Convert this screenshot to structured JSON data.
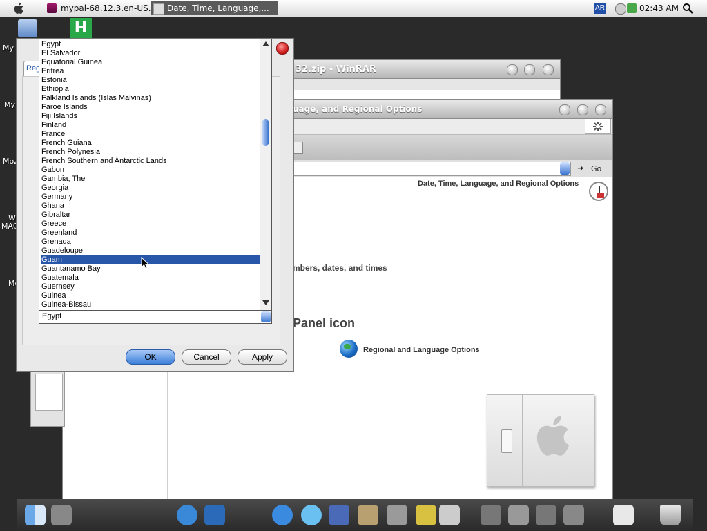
{
  "menubar": {
    "taskbar": [
      {
        "label": "mypal-68.12.3.en-US...."
      },
      {
        "label": "Date, Time, Language,..."
      }
    ],
    "lang": "AR",
    "clock": "02:43 AM"
  },
  "desktop": {
    "labels": [
      "My I",
      "My",
      "Moz",
      "W",
      "MAC",
      "Me"
    ]
  },
  "winrar": {
    "title": "32.zip - WinRAR"
  },
  "control_panel": {
    "title": "uage, and Regional Options",
    "address_go": "Go",
    "header": "Date, Time, Language, and Regional Options",
    "task_text": "mbers, dates, and times",
    "panel_heading": "Panel icon",
    "regional_link": "Regional and Language Options"
  },
  "dialog": {
    "tab_fragment": "Reg",
    "countries": [
      "Egypt",
      "El Salvador",
      "Equatorial Guinea",
      "Eritrea",
      "Estonia",
      "Ethiopia",
      "Falkland Islands (Islas Malvinas)",
      "Faroe Islands",
      "Fiji Islands",
      "Finland",
      "France",
      "French Guiana",
      "French Polynesia",
      "French Southern and Antarctic Lands",
      "Gabon",
      "Gambia, The",
      "Georgia",
      "Germany",
      "Ghana",
      "Gibraltar",
      "Greece",
      "Greenland",
      "Grenada",
      "Guadeloupe",
      "Guam",
      "Guantanamo Bay",
      "Guatemala",
      "Guernsey",
      "Guinea",
      "Guinea-Bissau"
    ],
    "selected_country": "Guam",
    "combo_value": "Egypt",
    "ok_label": "OK",
    "cancel_label": "Cancel",
    "apply_label": "Apply"
  }
}
